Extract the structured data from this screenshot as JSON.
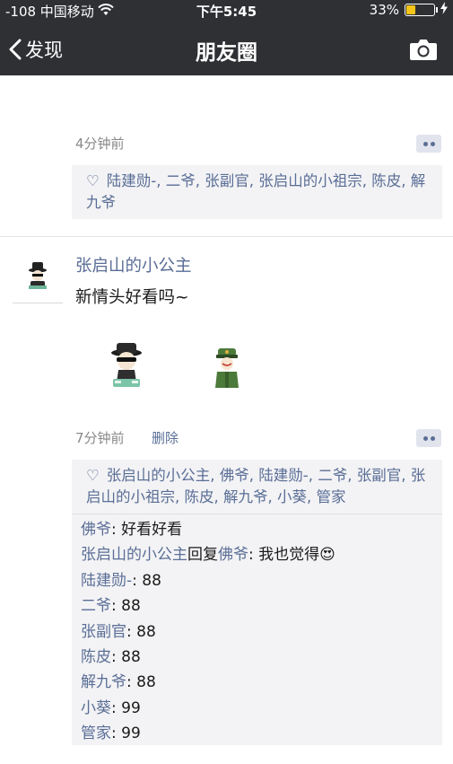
{
  "status_bar": {
    "carrier": "-108 中国移动",
    "time": "下午5:45",
    "battery": "33%",
    "battery_level": 0.33
  },
  "nav": {
    "back_label": "发现",
    "title": "朋友圈"
  },
  "post1": {
    "time": "4分钟前",
    "likes": "陆建勋-, 二爷, 张副官, 张启山的小祖宗, 陈皮, 解九爷"
  },
  "post2": {
    "author": "张启山的小公主",
    "text": "新情头好看吗~",
    "time": "7分钟前",
    "delete_label": "删除",
    "likes": "张启山的小公主, 佛爷, 陆建勋-, 二爷, 张副官, 张启山的小祖宗, 陈皮, 解九爷, 小葵, 管家",
    "comments": [
      {
        "name": "佛爷",
        "text": ": 好看好看"
      },
      {
        "name": "张启山的小公主",
        "reply_word": "回复",
        "reply_to": "佛爷",
        "text": ": 我也觉得😍"
      },
      {
        "name": "陆建勋-",
        "text": ": 88"
      },
      {
        "name": "二爷",
        "text": ": 88"
      },
      {
        "name": "张副官",
        "text": ": 88"
      },
      {
        "name": "陈皮",
        "text": ": 88"
      },
      {
        "name": "解九爷",
        "text": ": 88"
      },
      {
        "name": "小葵",
        "text": ": 99"
      },
      {
        "name": "管家",
        "text": ": 99"
      }
    ]
  },
  "colors": {
    "header_bg": "#2f3034",
    "link_blue": "#5a6e96",
    "battery": "#f5c518",
    "like_box_bg": "#f3f3f5"
  },
  "icons": [
    "wifi-icon",
    "battery-icon",
    "charging-bolt-icon",
    "back-chevron-icon",
    "camera-icon",
    "heart-icon",
    "more-dots-icon"
  ]
}
